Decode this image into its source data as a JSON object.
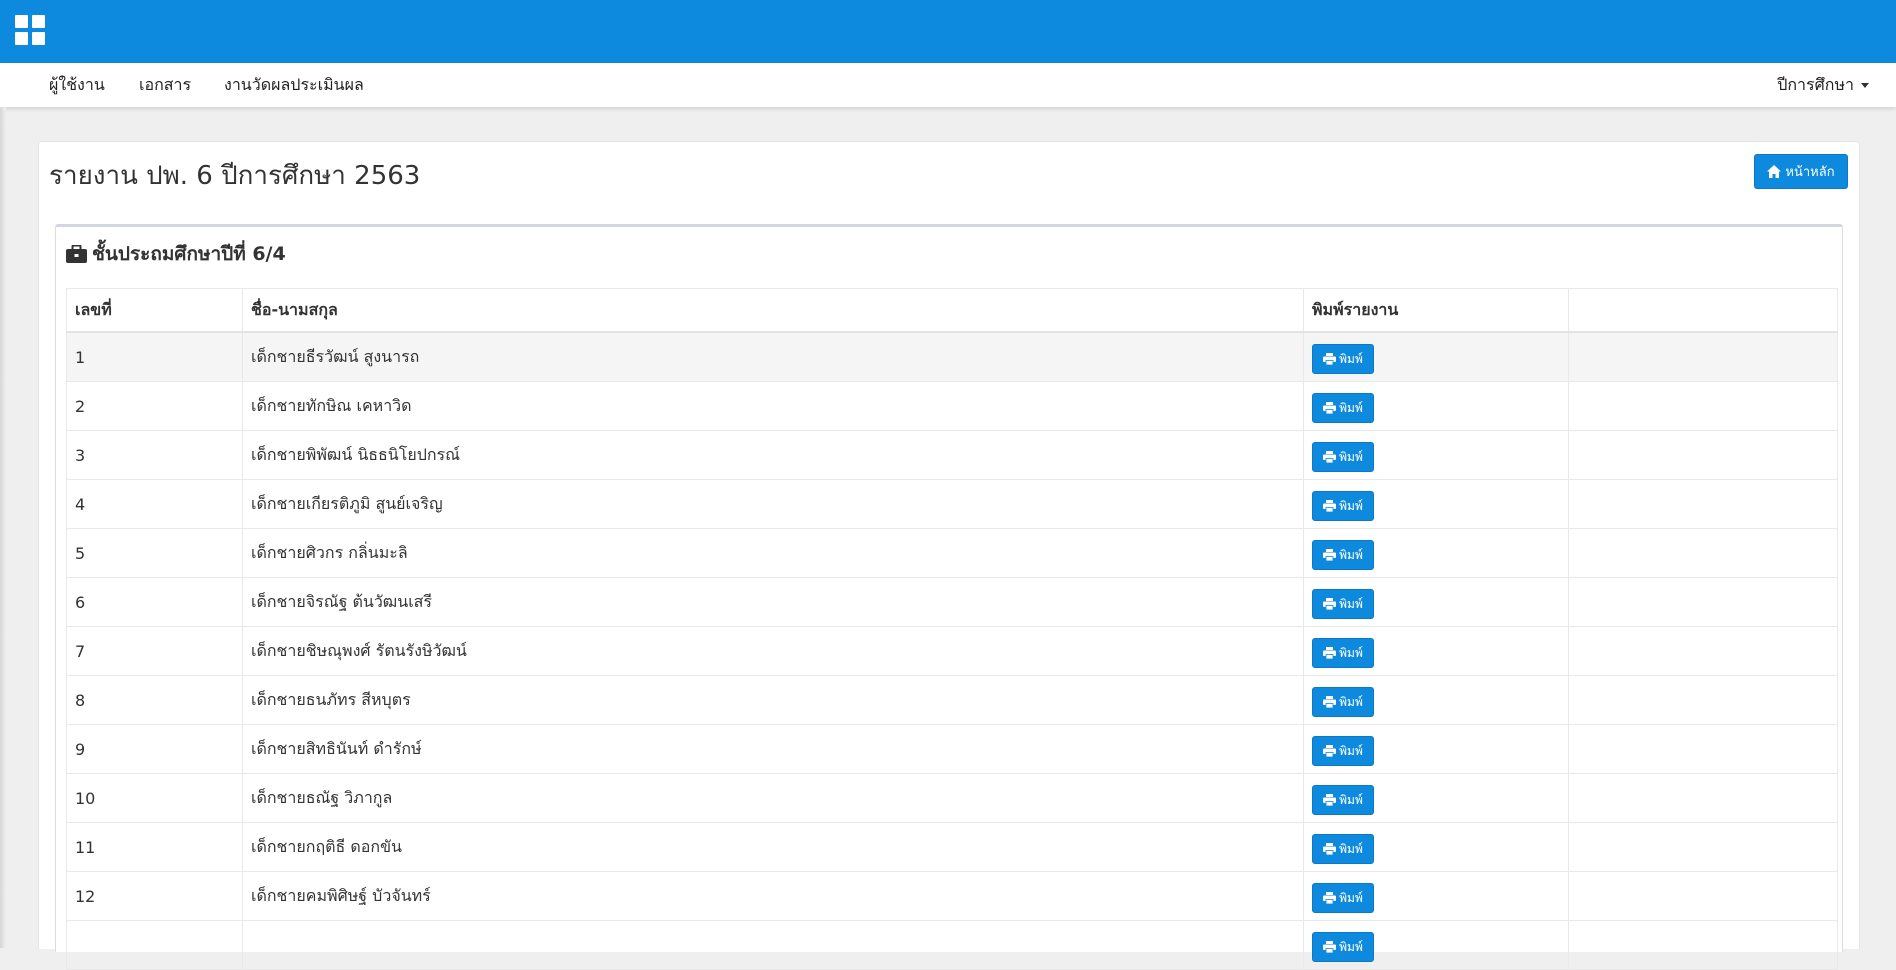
{
  "header": {
    "logo_icon": "grid-apps-icon",
    "bar_color": "#0d8ade"
  },
  "nav": {
    "items": [
      {
        "label": "ผู้ใช้งาน"
      },
      {
        "label": "เอกสาร"
      },
      {
        "label": "งานวัดผลประเมินผล"
      }
    ],
    "right_dropdown": "ปีการศึกษา"
  },
  "page": {
    "title": "รายงาน ปพ. 6 ปีการศึกษา 2563",
    "home_button": "หน้าหลัก",
    "home_icon": "home-icon"
  },
  "panel": {
    "heading": "ชั้นประถมศึกษาปีที่ 6/4",
    "heading_icon": "briefcase-icon"
  },
  "table": {
    "columns": [
      "เลขที่",
      "ชื่อ-นามสกุล",
      "พิมพ์รายงาน",
      ""
    ],
    "print_label": "พิมพ์",
    "print_icon": "printer-icon",
    "rows": [
      {
        "no": "1",
        "name": "เด็กชายธีรวัฒน์ สูงนารถ"
      },
      {
        "no": "2",
        "name": "เด็กชายทักษิณ เคหาวิด"
      },
      {
        "no": "3",
        "name": "เด็กชายพิพัฒน์ นิธธนิโยปกรณ์"
      },
      {
        "no": "4",
        "name": "เด็กชายเกียรติภูมิ สูนย์เจริญ"
      },
      {
        "no": "5",
        "name": "เด็กชายศิวกร กลิ่นมะลิ"
      },
      {
        "no": "6",
        "name": "เด็กชายจิรณัฐ ต้นวัฒนเสรี"
      },
      {
        "no": "7",
        "name": "เด็กชายชิษณุพงศ์ รัตนรังษิวัฒน์"
      },
      {
        "no": "8",
        "name": "เด็กชายธนภัทร สีหบุตร"
      },
      {
        "no": "9",
        "name": "เด็กชายสิทธินันท์ ดำรักษ์"
      },
      {
        "no": "10",
        "name": "เด็กชายธณัฐ วิภากูล"
      },
      {
        "no": "11",
        "name": "เด็กชายกฤติธี ดอกขัน"
      },
      {
        "no": "12",
        "name": "เด็กชายคมพิศิษฐ์ บัวจันทร์"
      },
      {
        "no": "",
        "name": ""
      }
    ]
  },
  "colors": {
    "accent": "#0d8ade",
    "background": "#efefef"
  }
}
